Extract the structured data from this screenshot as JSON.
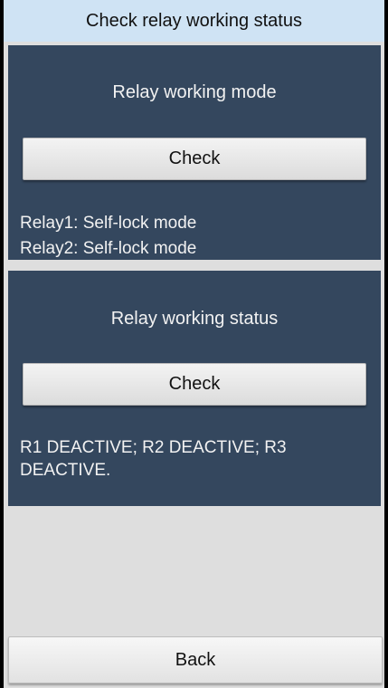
{
  "header": {
    "title": "Check relay working status"
  },
  "mode_panel": {
    "heading": "Relay working mode",
    "button_label": "Check",
    "results": [
      "Relay1: Self-lock mode",
      "Relay2: Self-lock mode"
    ]
  },
  "status_panel": {
    "heading": "Relay working status",
    "button_label": "Check",
    "result": "R1 DEACTIVE; R2 DEACTIVE; R3 DEACTIVE."
  },
  "footer": {
    "back_label": "Back"
  },
  "colors": {
    "title_bar": "#cfe3f4",
    "panel": "#34475e",
    "background": "#dedede"
  }
}
